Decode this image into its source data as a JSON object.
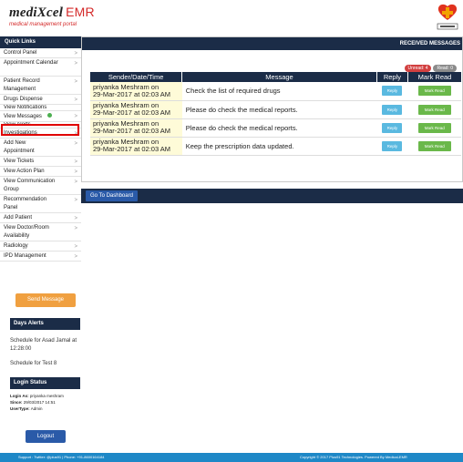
{
  "header": {
    "title_main": "mediXcel",
    "title_suffix": "EMR",
    "subtitle": "medical management portal"
  },
  "sidebar": {
    "title": "Quick Links",
    "items": [
      {
        "label": "Control Panel"
      },
      {
        "label": "Appointment Calendar"
      },
      {
        "label": "Patient Record Management"
      },
      {
        "label": "Drugs Dispense"
      },
      {
        "label": "View Notifications"
      },
      {
        "label": "View Messages"
      },
      {
        "label": "View Alerts"
      },
      {
        "label": "Investigations"
      },
      {
        "label": "Add New Appointment"
      },
      {
        "label": "View Tickets"
      },
      {
        "label": "View Action Plan"
      },
      {
        "label": "View Communication Group"
      },
      {
        "label": "Recommendation Panel"
      },
      {
        "label": "Add Patient"
      },
      {
        "label": "View Doctor/Room Availability"
      },
      {
        "label": "Radiology"
      },
      {
        "label": "IPD Management"
      }
    ],
    "send_message": "Send Message"
  },
  "alerts": {
    "title": "Days Alerts",
    "items": [
      "Schedule for Asad Jamal at 12:28:00",
      "Schedule for Test 8"
    ]
  },
  "login": {
    "title": "Login Status",
    "login_as_label": "Login As:",
    "login_as": "priyanka meshram",
    "since_label": "Since:",
    "since": "29/03/2017 14:51",
    "usertype_label": "UserType:",
    "usertype": "Admin",
    "logout": "Logout"
  },
  "main": {
    "header": "RECEIVED MESSAGES",
    "unread": "Unread: 4",
    "read": "Read: 0",
    "columns": {
      "sender": "Sender/Date/Time",
      "message": "Message",
      "reply": "Reply",
      "mark_read": "Mark Read"
    },
    "rows": [
      {
        "sender": "priyanka Meshram on",
        "date": "29-Mar-2017 at 02:03 AM",
        "message": "Check the list of required drugs",
        "reply": "Reply",
        "mark": "Mark Read"
      },
      {
        "sender": "priyanka Meshram on",
        "date": "29-Mar-2017 at 02:03 AM",
        "message": "Please do check the medical reports.",
        "reply": "Reply",
        "mark": "Mark Read"
      },
      {
        "sender": "priyanka Meshram on",
        "date": "29-Mar-2017 at 02:03 AM",
        "message": "Please do check the medical reports.",
        "reply": "Reply",
        "mark": "Mark Read"
      },
      {
        "sender": "priyanka Meshram on",
        "date": "29-Mar-2017 at 02:03 AM",
        "message": "Keep the prescription data updated.",
        "reply": "Reply",
        "mark": "Mark Read"
      }
    ],
    "dashboard": "Go To Dashboard"
  },
  "footer": {
    "left": "Support : Twitter: @plus91 | Phone: +91-8600164184",
    "right": "Copyright © 2017 Plus91 Technologies. Powered By Medical-EMR"
  },
  "colors": {
    "navy": "#1b2c47",
    "accent_red": "#d42a2a",
    "reply_blue": "#5ab9e0",
    "mark_green": "#6ab84a",
    "send_orange": "#f0a040",
    "footer_blue": "#1e88c7"
  }
}
